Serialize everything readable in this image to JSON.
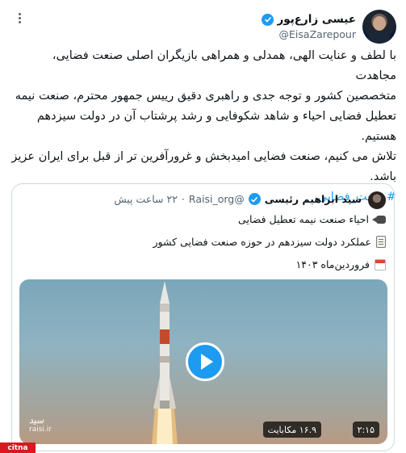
{
  "author": {
    "name": "عیسی زارع‌پور",
    "handle": "@EisaZarepour"
  },
  "tweet": {
    "line1": "با لطف و عنایت الهی، همدلی و همراهی بازیگران اصلی صنعت فضایی، مجاهدت",
    "line2": "متخصصین کشور و توجه جدی و راهبری دقیق رییس جمهور محترم، صنعت نیمه",
    "line3": "تعطیل فضایی احیاء و شاهد شکوفایی و رشد پرشتاب آن در دولت سیزدهم",
    "line4": "هستیم.",
    "line5": "تلاش می کنیم، صنعت فضایی امیدبخش و غرورآفرین تر از قبل برای ایران عزیز",
    "line6": "باشد.",
    "hashtag": "#صنعت_فضایی"
  },
  "quote": {
    "name": "سید ابراهیم رئیسی",
    "handle": "@Raisi_org",
    "time": "۲۲ ساعت پیش",
    "bullet1": "احیاء صنعت نیمه تعطیل فضایی",
    "bullet2": "عملکرد دولت سیزدهم در حوزه صنعت فضایی کشور",
    "bullet3": "فروردین‌ماه ۱۴۰۳",
    "video": {
      "duration": "۲:۱۵",
      "views": "۱۶.۹ مکابایت",
      "watermark": "raisi.ir"
    }
  },
  "site_logo": "citna",
  "colors": {
    "accent": "#1d9bf0",
    "verified": "#1d9bf0",
    "logo": "#d71920"
  },
  "icons": [
    "more-icon",
    "verified-icon",
    "camera-icon",
    "clipboard-icon",
    "calendar-icon",
    "play-icon"
  ]
}
